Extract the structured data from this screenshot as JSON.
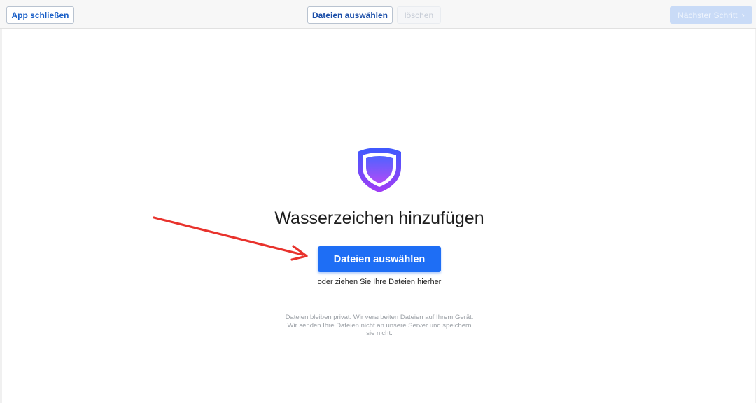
{
  "toolbar": {
    "close_label": "App schließen",
    "select_files_label": "Dateien auswählen",
    "delete_label": "löschen",
    "next_step_label": "Nächster Schritt",
    "next_step_icon": "chevron-right-icon"
  },
  "main": {
    "logo_icon": "shield-icon",
    "title": "Wasserzeichen hinzufügen",
    "select_files_button": "Dateien auswählen",
    "drop_hint": "oder ziehen Sie Ihre Dateien hierher",
    "privacy_line1": "Dateien bleiben privat. Wir verarbeiten Dateien auf Ihrem Gerät.",
    "privacy_line2": "Wir senden Ihre Dateien nicht an unsere Server und speichern",
    "privacy_line3": "sie nicht."
  },
  "colors": {
    "primary": "#1e6ef5",
    "shield_gradient_top": "#3d5afe",
    "shield_gradient_bottom": "#a23cf5",
    "annotation_arrow": "#e8322c"
  }
}
